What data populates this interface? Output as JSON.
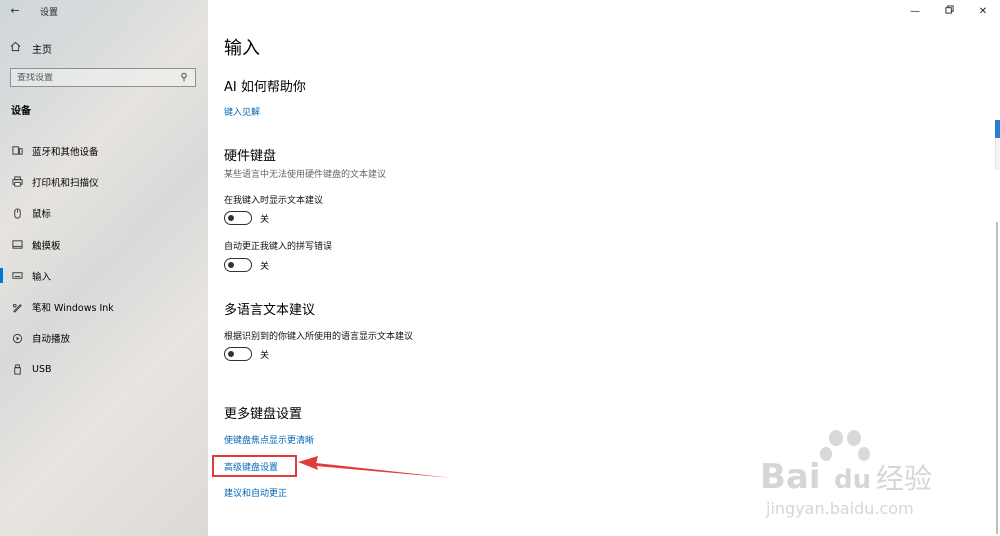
{
  "window": {
    "title": "设置",
    "back_icon": "arrow-left-icon",
    "controls": [
      "minimize-icon",
      "restore-icon",
      "close-icon"
    ]
  },
  "sidebar": {
    "home_label": "主页",
    "search_placeholder": "查找设置",
    "section_label": "设备",
    "items": [
      {
        "label": "蓝牙和其他设备",
        "icon": "bluetooth-devices-icon"
      },
      {
        "label": "打印机和扫描仪",
        "icon": "printer-icon"
      },
      {
        "label": "鼠标",
        "icon": "mouse-icon"
      },
      {
        "label": "触摸板",
        "icon": "touchpad-icon"
      },
      {
        "label": "输入",
        "icon": "keyboard-icon",
        "active": true
      },
      {
        "label": "笔和 Windows Ink",
        "icon": "pen-icon"
      },
      {
        "label": "自动播放",
        "icon": "autoplay-icon"
      },
      {
        "label": "USB",
        "icon": "usb-icon"
      }
    ]
  },
  "main": {
    "title": "输入",
    "ai_section": {
      "heading": "AI 如何帮助你",
      "link": "键入见解"
    },
    "hardware_section": {
      "heading": "硬件键盘",
      "description": "某些语言中无法使用硬件键盘的文本建议",
      "settings": [
        {
          "label": "在我键入时显示文本建议",
          "state": "关"
        },
        {
          "label": "自动更正我键入的拼写错误",
          "state": "关"
        }
      ]
    },
    "multilang_section": {
      "heading": "多语言文本建议",
      "settings": [
        {
          "label": "根据识别到的你键入所使用的语言显示文本建议",
          "state": "关"
        }
      ]
    },
    "more_section": {
      "heading": "更多键盘设置",
      "links": [
        "使键盘焦点显示更清晰",
        "高级键盘设置",
        "建议和自动更正"
      ]
    }
  },
  "watermark": {
    "brand": "Bai",
    "brand2": "du",
    "cn": "经验",
    "url": "jingyan.baidu.com"
  },
  "colors": {
    "accent": "#0078d7",
    "link": "#0067b8",
    "annotation": "#e23b3b"
  }
}
